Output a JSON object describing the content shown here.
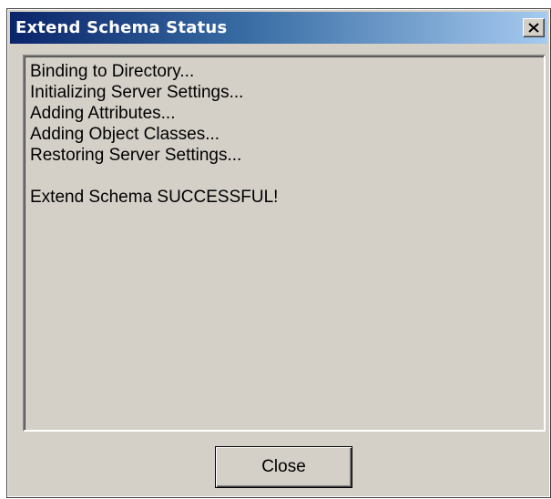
{
  "window": {
    "title": "Extend Schema Status"
  },
  "titlebar": {
    "close_icon": "close-x-icon"
  },
  "log": {
    "lines": [
      "Binding to Directory...",
      "Initializing Server Settings...",
      "Adding Attributes...",
      "Adding Object Classes...",
      "Restoring Server Settings...",
      "",
      "Extend Schema SUCCESSFUL!"
    ]
  },
  "buttons": {
    "close_label": "Close"
  },
  "colors": {
    "title_gradient_start": "#0a246a",
    "title_gradient_end": "#a6caf0",
    "face": "#d4d0c8"
  }
}
